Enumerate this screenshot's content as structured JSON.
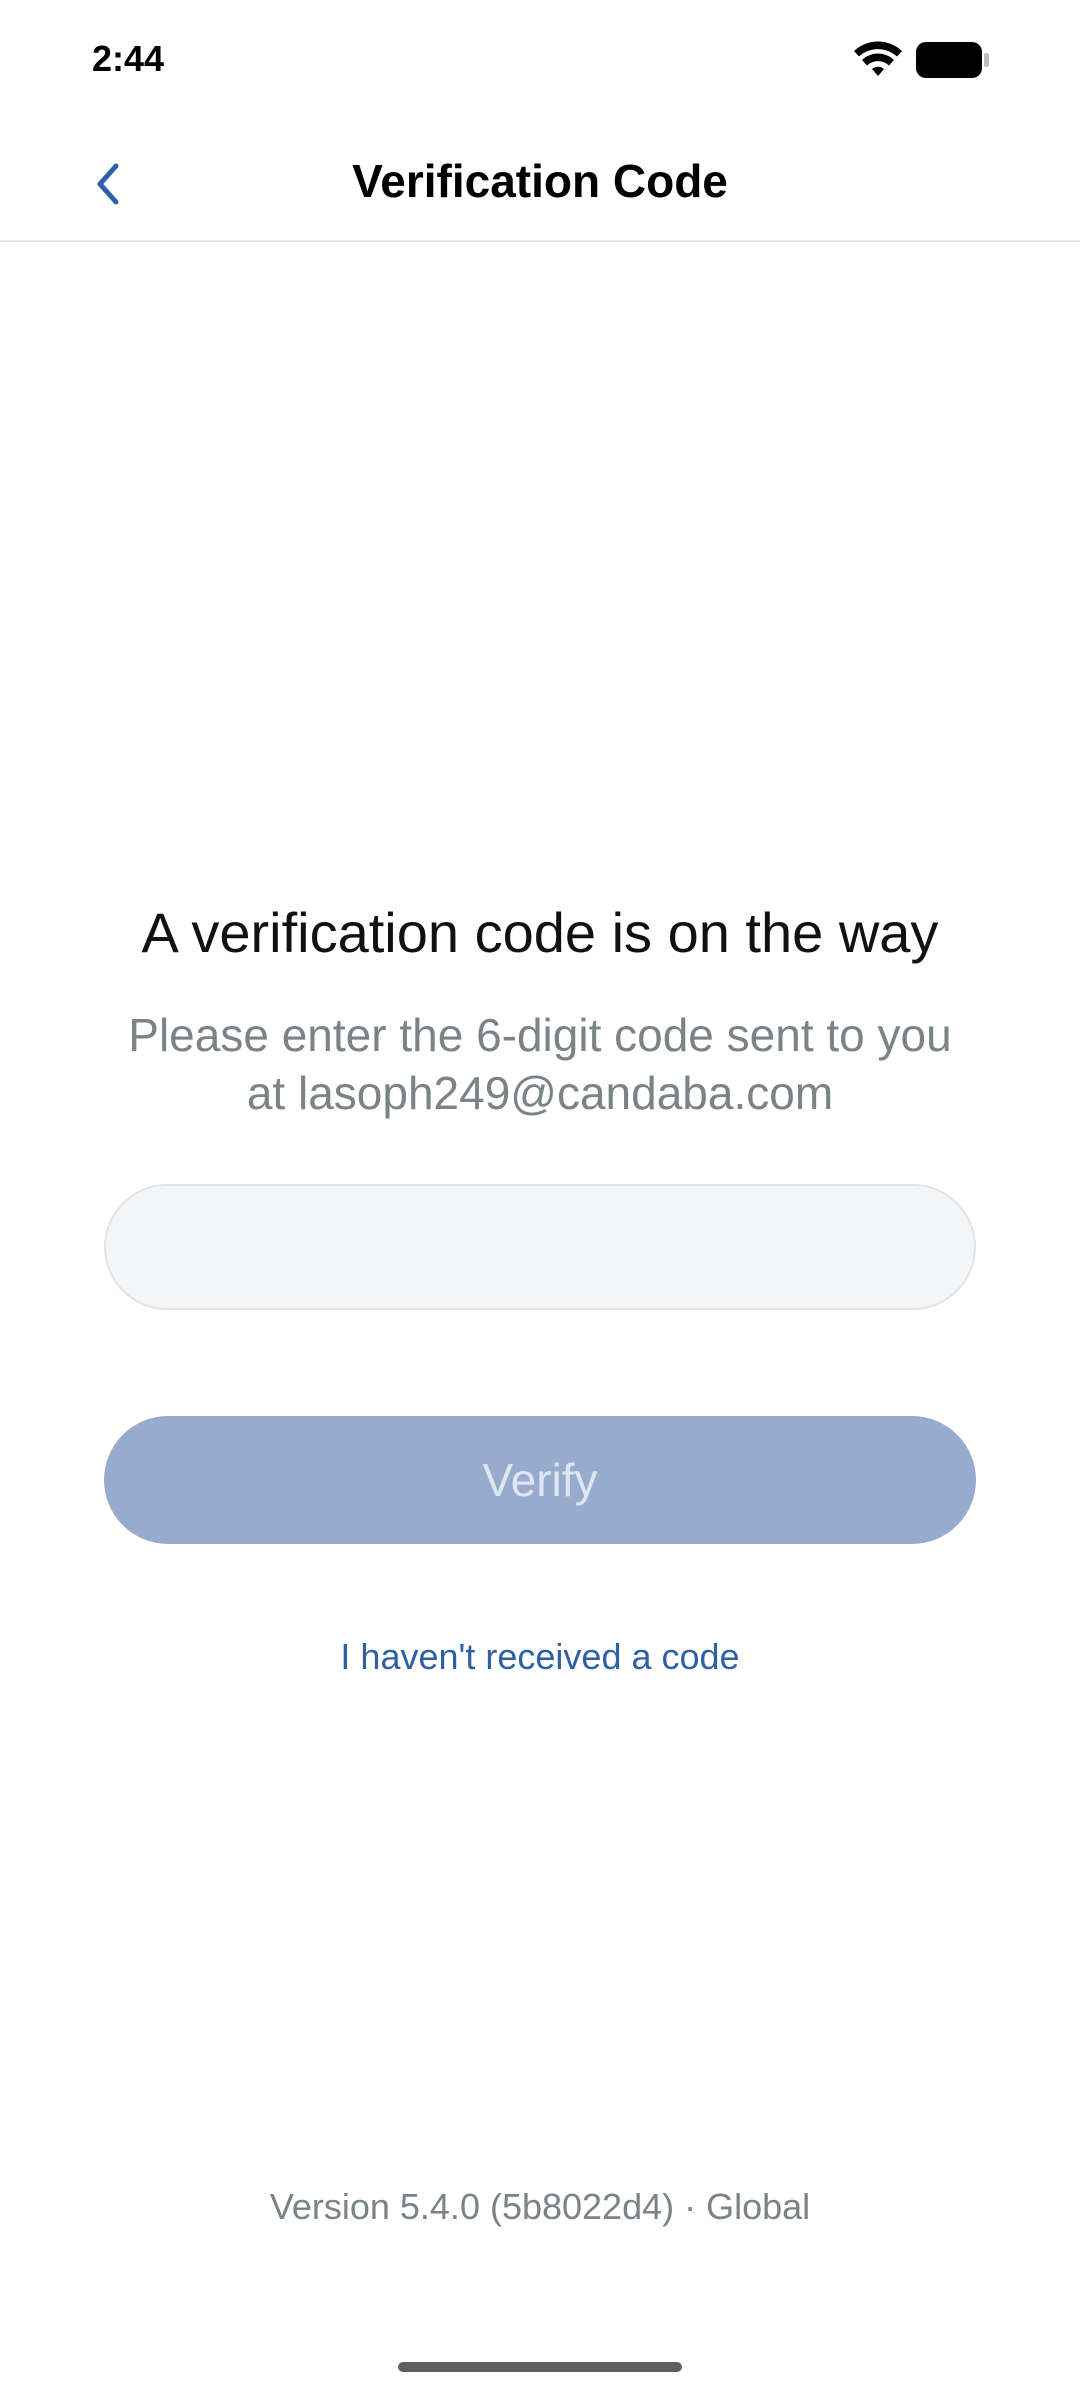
{
  "status_bar": {
    "time": "2:44"
  },
  "header": {
    "title": "Verification Code",
    "back_icon": "chevron-left-icon"
  },
  "content": {
    "heading": "A verification code is on the way",
    "subtext_line1": "Please enter the 6-digit code sent to you",
    "subtext_line2": "at lasoph249@candaba.com",
    "code_input": {
      "value": "",
      "placeholder": ""
    },
    "verify_label": "Verify",
    "resend_label": "I haven't received a code"
  },
  "footer": {
    "version": "Version 5.4.0 (5b8022d4) · Global"
  },
  "colors": {
    "accent": "#2f5fa7",
    "button_disabled": "#97abcf",
    "muted_text": "#7a8487"
  }
}
